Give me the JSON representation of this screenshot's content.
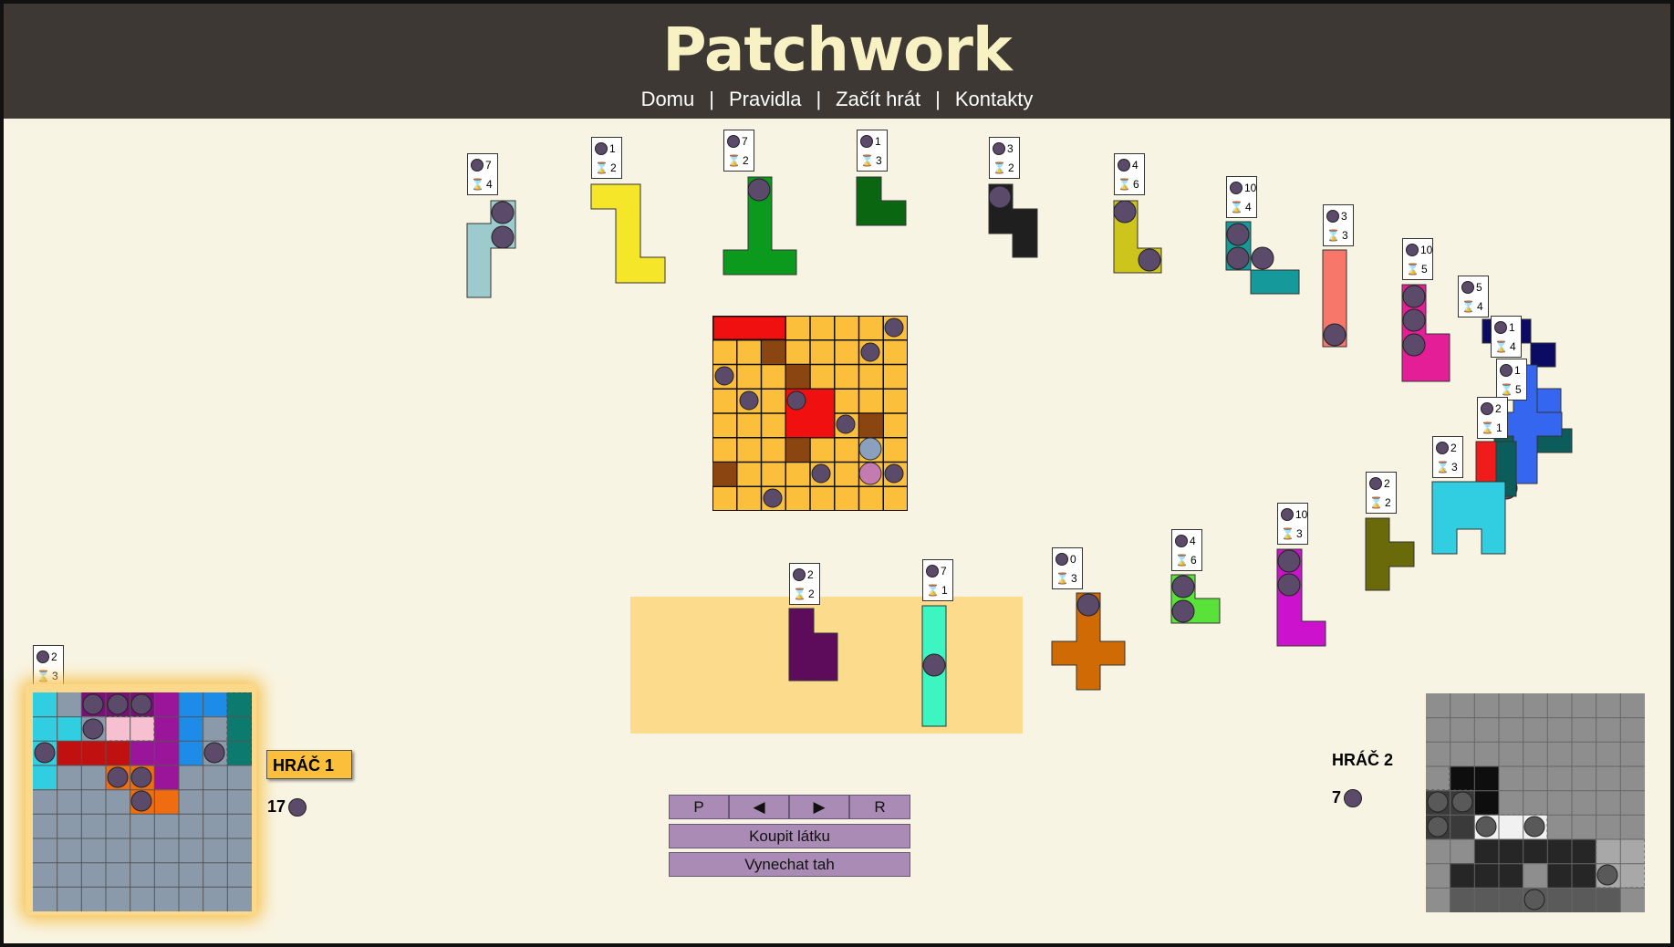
{
  "header": {
    "title": "Patchwork",
    "nav": [
      "Domu",
      "Pravidla",
      "Začít hrát",
      "Kontakty"
    ]
  },
  "patches": [
    {
      "cost": "7",
      "time": "4",
      "color": "#9ccacd"
    },
    {
      "cost": "1",
      "time": "2",
      "color": "#f5e62a"
    },
    {
      "cost": "7",
      "time": "2",
      "color": "#0b9a1e"
    },
    {
      "cost": "1",
      "time": "3",
      "color": "#0b6612"
    },
    {
      "cost": "3",
      "time": "2",
      "color": "#1f1f1f"
    },
    {
      "cost": "4",
      "time": "6",
      "color": "#cdc51c"
    },
    {
      "cost": "10",
      "time": "4",
      "color": "#15999a"
    },
    {
      "cost": "3",
      "time": "3",
      "color": "#f7786a"
    },
    {
      "cost": "10",
      "time": "5",
      "color": "#e41e96"
    },
    {
      "cost": "5",
      "time": "4",
      "color": "#0b0b63"
    },
    {
      "cost": "1",
      "time": "4",
      "color": "#0c5c5c"
    },
    {
      "cost": "1",
      "time": "5",
      "color": "#3466f0"
    },
    {
      "cost": "2",
      "time": "1",
      "color": "#f01c1c"
    },
    {
      "cost": "2",
      "time": "3",
      "color": "#31cde0"
    },
    {
      "cost": "2",
      "time": "2",
      "color": "#6b6a0b"
    },
    {
      "cost": "10",
      "time": "3",
      "color": "#cc12cc"
    },
    {
      "cost": "4",
      "time": "6",
      "color": "#58e23a"
    },
    {
      "cost": "0",
      "time": "3",
      "color": "#cf6a05"
    },
    {
      "cost": "7",
      "time": "1",
      "color": "#3df5c0"
    },
    {
      "cost": "2",
      "time": "2",
      "color": "#5c0c5a"
    },
    {
      "cost": "2",
      "time": "3",
      "color": "#888"
    }
  ],
  "controls": {
    "nav_buttons": [
      "P",
      "◀",
      "▶",
      "R"
    ],
    "buy_label": "Koupit látku",
    "skip_label": "Vynechat tah"
  },
  "player1": {
    "name": "HRÁČ 1",
    "buttons": "17"
  },
  "player2": {
    "name": "HRÁČ 2",
    "buttons": "7"
  },
  "colors": {
    "header_bg": "#3d3833",
    "title": "#f7f1c3",
    "page_bg": "#f8f4e3",
    "button": "#a98bb5",
    "highlight": "#fcd98a"
  }
}
